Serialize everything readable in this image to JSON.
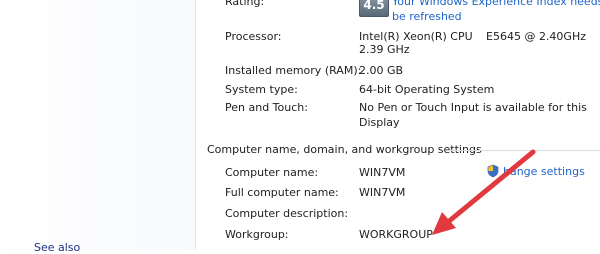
{
  "left_nav": {
    "partial_label": "See also"
  },
  "rating": {
    "label": "Rating:",
    "score": "4.5",
    "link_line1": "Your Windows Experience Index needs to",
    "link_line2": "be refreshed"
  },
  "system": {
    "processor_label": "Processor:",
    "processor_value_line1": "Intel(R) Xeon(R) CPU",
    "processor_value_speed": "E5645  @ 2.40GHz",
    "processor_value_line2": "2.39 GHz",
    "memory_label": "Installed memory (RAM):",
    "memory_value": "2.00 GB",
    "type_label": "System type:",
    "type_value": "64-bit Operating System",
    "pen_label": "Pen and Touch:",
    "pen_value_line1": "No Pen or Touch Input is available for this",
    "pen_value_line2": "Display"
  },
  "computer_section": {
    "title": "Computer name, domain, and workgroup settings",
    "name_label": "Computer name:",
    "name_value": "WIN7VM",
    "full_name_label": "Full computer name:",
    "full_name_value": "WIN7VM",
    "description_label": "Computer description:",
    "description_value": "",
    "workgroup_label": "Workgroup:",
    "workgroup_value": "WORKGROUP",
    "change_settings_label": "Change settings",
    "change_settings_text": "hange settings"
  },
  "annotation": {
    "arrow_color": "#e0393e"
  },
  "colors": {
    "link": "#1e64c8",
    "text": "#1e1e1e"
  }
}
